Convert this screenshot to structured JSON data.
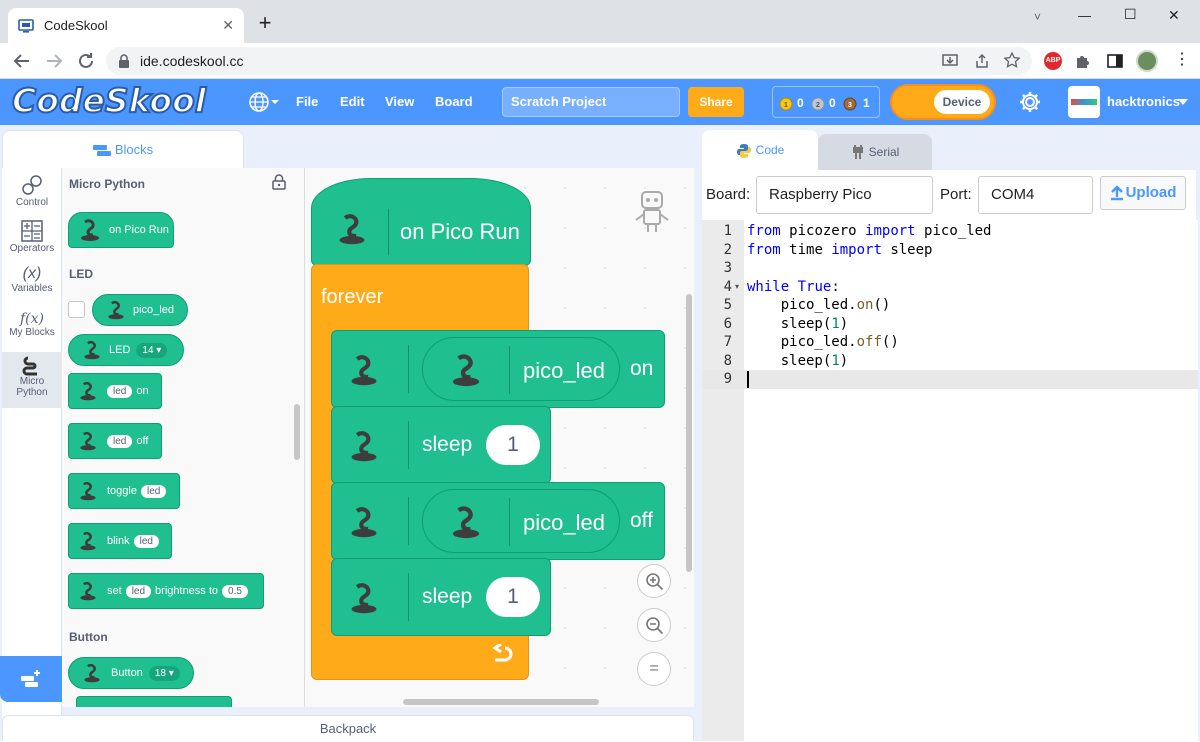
{
  "browser": {
    "tab_title": "CodeSkool",
    "new_tab": "+",
    "url": "ide.codeskool.cc",
    "window_controls": [
      "˅",
      "—",
      "☐",
      "✕"
    ],
    "ext_abp": "ABP"
  },
  "header": {
    "logo": "CodeSkool",
    "menu": {
      "file": "File",
      "edit": "Edit",
      "view": "View",
      "board": "Board"
    },
    "project_name": "Scratch Project",
    "share": "Share",
    "badges": {
      "gold": "0",
      "silver": "0",
      "bronze": "1"
    },
    "device": "Device",
    "user": "hacktronics"
  },
  "left_tabs": {
    "blocks": "Blocks"
  },
  "categories": [
    {
      "label": "Control",
      "icon": "control-icon"
    },
    {
      "label": "Operators",
      "icon": "operators-icon"
    },
    {
      "label": "Variables",
      "icon": "variables-icon",
      "glyph": "(x)"
    },
    {
      "label": "My Blocks",
      "icon": "my-blocks-icon",
      "glyph": "f(x)"
    },
    {
      "label": "Micro Python",
      "icon": "micro-python-icon"
    }
  ],
  "palette": {
    "heading": "Micro Python",
    "hat_label": "on Pico Run",
    "led_section": "LED",
    "pico_led": "pico_led",
    "led_label": "LED",
    "led_pin": "14",
    "led_word": "led",
    "on_word": "on",
    "off_word": "off",
    "toggle_word": "toggle",
    "blink_word": "blink",
    "set_word": "set",
    "brightness_word": "brightness to",
    "brightness_val": "0.5",
    "button_section": "Button",
    "button_label": "Button",
    "button_pin": "18"
  },
  "workspace": {
    "hat": "on Pico Run",
    "forever": "forever",
    "pico_led": "pico_led",
    "on": "on",
    "off": "off",
    "sleep": "sleep",
    "sleep_val_1": "1",
    "sleep_val_2": "1",
    "zoom_reset": "="
  },
  "backpack": "Backpack",
  "right_tabs": {
    "code": "Code",
    "serial": "Serial"
  },
  "board_bar": {
    "board_label": "Board:",
    "board_value": "Raspberry Pico",
    "port_label": "Port:",
    "port_value": "COM4",
    "upload": "Upload"
  },
  "code_lines": [
    "from picozero import pico_led",
    "from time import sleep",
    "",
    "while True:",
    "    pico_led.on()",
    "    sleep(1)",
    "    pico_led.off()",
    "    sleep(1)",
    ""
  ],
  "colors": {
    "brand": "#4c97ff",
    "python_block": "#1fbf8f",
    "control_block": "#ffab19",
    "share": "#ffab19"
  }
}
